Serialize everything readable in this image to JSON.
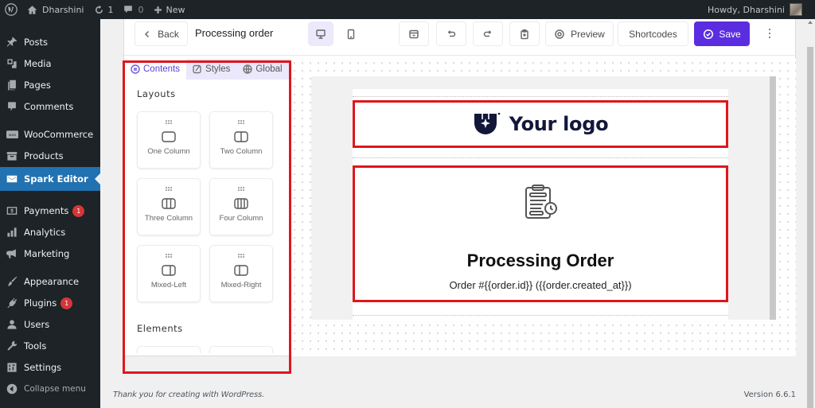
{
  "adminbar": {
    "site_name": "Dharshini",
    "updates_count": "1",
    "comments_count": "0",
    "new_label": "New",
    "greeting": "Howdy, Dharshini"
  },
  "sidebar": {
    "items": [
      {
        "label": "Posts",
        "icon": "pushpin-icon"
      },
      {
        "label": "Media",
        "icon": "media-icon"
      },
      {
        "label": "Pages",
        "icon": "pages-icon"
      },
      {
        "label": "Comments",
        "icon": "comment-icon"
      },
      {
        "label": "WooCommerce",
        "icon": "woocommerce-icon"
      },
      {
        "label": "Products",
        "icon": "archive-icon"
      },
      {
        "label": "Spark Editor",
        "icon": "email-icon",
        "active": true
      },
      {
        "label": "Payments",
        "icon": "dollar-icon",
        "badge": "1"
      },
      {
        "label": "Analytics",
        "icon": "bar-chart-icon"
      },
      {
        "label": "Marketing",
        "icon": "megaphone-icon"
      },
      {
        "label": "Appearance",
        "icon": "paintbrush-icon"
      },
      {
        "label": "Plugins",
        "icon": "plug-icon",
        "badge": "1"
      },
      {
        "label": "Users",
        "icon": "user-icon"
      },
      {
        "label": "Tools",
        "icon": "wrench-icon"
      },
      {
        "label": "Settings",
        "icon": "settings-icon"
      },
      {
        "label": "Collapse menu",
        "icon": "collapse-icon"
      }
    ]
  },
  "toolbar": {
    "back_label": "Back",
    "template_title": "Processing order",
    "preview_label": "Preview",
    "shortcodes_label": "Shortcodes",
    "save_label": "Save",
    "accent_color": "#5b2de0"
  },
  "panel": {
    "tabs": [
      {
        "label": "Contents",
        "active": true
      },
      {
        "label": "Styles"
      },
      {
        "label": "Global"
      }
    ],
    "layouts_title": "Layouts",
    "layouts": [
      {
        "label": "One Column"
      },
      {
        "label": "Two Column"
      },
      {
        "label": "Three Column"
      },
      {
        "label": "Four Column"
      },
      {
        "label": "Mixed-Left"
      },
      {
        "label": "Mixed-Right"
      }
    ],
    "elements_title": "Elements"
  },
  "canvas": {
    "logo_text": "Your logo",
    "heading": "Processing Order",
    "subtext": "Order #{{order.id}} ({{order.created_at}})"
  },
  "footer": {
    "thanks": "Thank you for creating with WordPress.",
    "version": "Version 6.6.1"
  }
}
